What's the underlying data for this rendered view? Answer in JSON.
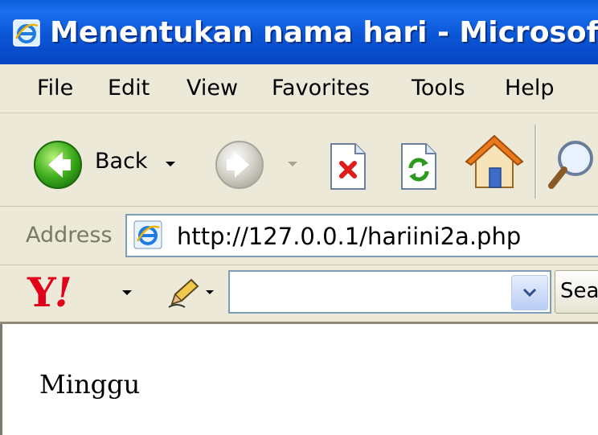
{
  "window": {
    "title": "Menentukan nama hari - Microsoft Internet Explorer"
  },
  "menubar": {
    "items": [
      {
        "label": "File"
      },
      {
        "label": "Edit"
      },
      {
        "label": "View"
      },
      {
        "label": "Favorites"
      },
      {
        "label": "Tools"
      },
      {
        "label": "Help"
      }
    ]
  },
  "toolbar": {
    "back_label": "Back",
    "icons": [
      "back-arrow-icon",
      "forward-arrow-icon",
      "stop-icon",
      "refresh-icon",
      "home-icon",
      "search-magnifier-icon"
    ]
  },
  "address": {
    "label": "Address",
    "url": "http://127.0.0.1/hariini2a.php"
  },
  "yahoo_toolbar": {
    "search_value": "",
    "search_button_label": "Search Web",
    "colors": {
      "logo": "#e0001a"
    }
  },
  "page": {
    "text": "Minggu"
  },
  "colors": {
    "titlebar": "#0a56d6",
    "chrome": "#ece9d8"
  }
}
